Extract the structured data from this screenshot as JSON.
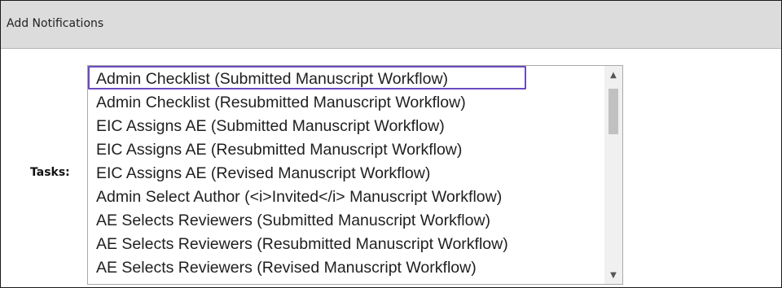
{
  "panel": {
    "title": "Add Notifications"
  },
  "form": {
    "tasks_label": "Tasks:"
  },
  "tasks_list": {
    "options": [
      "Admin Checklist (Submitted Manuscript Workflow)",
      "Admin Checklist (Resubmitted Manuscript Workflow)",
      "EIC Assigns AE (Submitted Manuscript Workflow)",
      "EIC Assigns AE (Resubmitted Manuscript Workflow)",
      "EIC Assigns AE (Revised Manuscript Workflow)",
      "Admin Select Author (<i>Invited</i> Manuscript Workflow)",
      "AE Selects Reviewers (Submitted Manuscript Workflow)",
      "AE Selects Reviewers (Resubmitted Manuscript Workflow)",
      "AE Selects Reviewers (Revised Manuscript Workflow)"
    ],
    "focused_index": 0,
    "up_arrow_icon": "triangle-up-icon",
    "down_arrow_icon": "triangle-down-icon"
  },
  "colors": {
    "header_bg": "#dcdcdc",
    "focus_ring": "#6a4bbf",
    "scroll_thumb": "#c1c1c1"
  }
}
